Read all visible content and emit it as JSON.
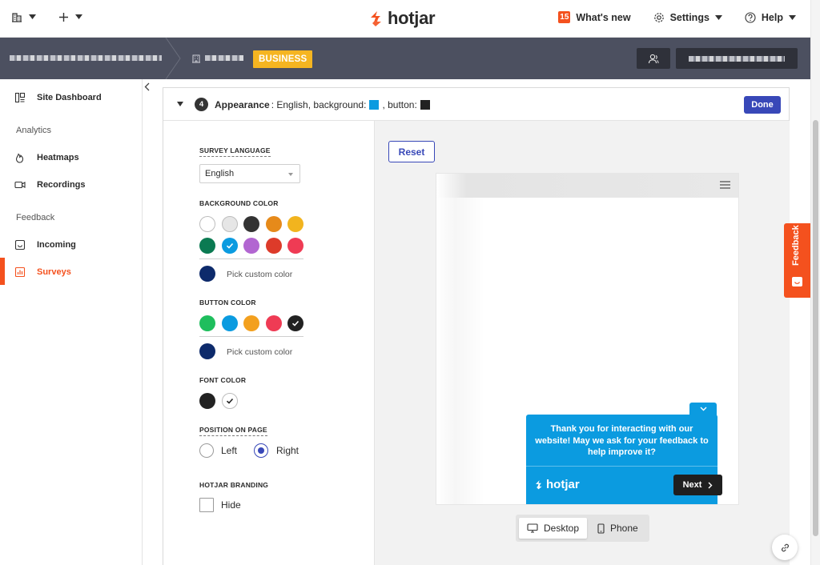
{
  "topbar": {
    "logo_text": "hotjar",
    "whats_new_count": "15",
    "whats_new_label": "What's new",
    "settings_label": "Settings",
    "help_label": "Help"
  },
  "header": {
    "plan_badge": "BUSINESS"
  },
  "sidebar": {
    "site_dashboard": "Site Dashboard",
    "analytics_heading": "Analytics",
    "heatmaps": "Heatmaps",
    "recordings": "Recordings",
    "feedback_heading": "Feedback",
    "incoming": "Incoming",
    "surveys": "Surveys"
  },
  "step": {
    "number": "4",
    "title": "Appearance",
    "summary_prefix": ": English, background:",
    "summary_button": ", button:",
    "bg_color": "#0b9be0",
    "button_color": "#222222",
    "done_label": "Done"
  },
  "settings": {
    "survey_language_label": "SURVEY LANGUAGE",
    "survey_language_value": "English",
    "background_color_label": "BACKGROUND COLOR",
    "background_colors": [
      "#ffffff",
      "#e6e6e6",
      "#333333",
      "#e68a1a",
      "#f2b41e",
      "#0b7a52",
      "#0b9be0",
      "#b266d1",
      "#dd3b2a",
      "#ef3b54"
    ],
    "background_custom_color": "#0d2a6b",
    "pick_custom_color_1": "Pick custom color",
    "button_color_label": "BUTTON COLOR",
    "button_colors": [
      "#1fbe5d",
      "#0b9be0",
      "#f3a01e",
      "#ef3b54",
      "#222222"
    ],
    "button_custom_color": "#0d2a6b",
    "pick_custom_color_2": "Pick custom color",
    "font_color_label": "FONT COLOR",
    "font_colors": [
      "#222222",
      "#ffffff"
    ],
    "position_label": "POSITION ON PAGE",
    "position_left": "Left",
    "position_right": "Right",
    "branding_label": "HOTJAR BRANDING",
    "branding_hide": "Hide"
  },
  "preview": {
    "reset_label": "Reset",
    "survey_question": "Thank you for interacting with our website! May we ask for your feedback to help improve it?",
    "survey_logo": "hotjar",
    "next_label": "Next",
    "desktop_label": "Desktop",
    "phone_label": "Phone"
  },
  "feedback_tab": {
    "label": "Feedback"
  }
}
